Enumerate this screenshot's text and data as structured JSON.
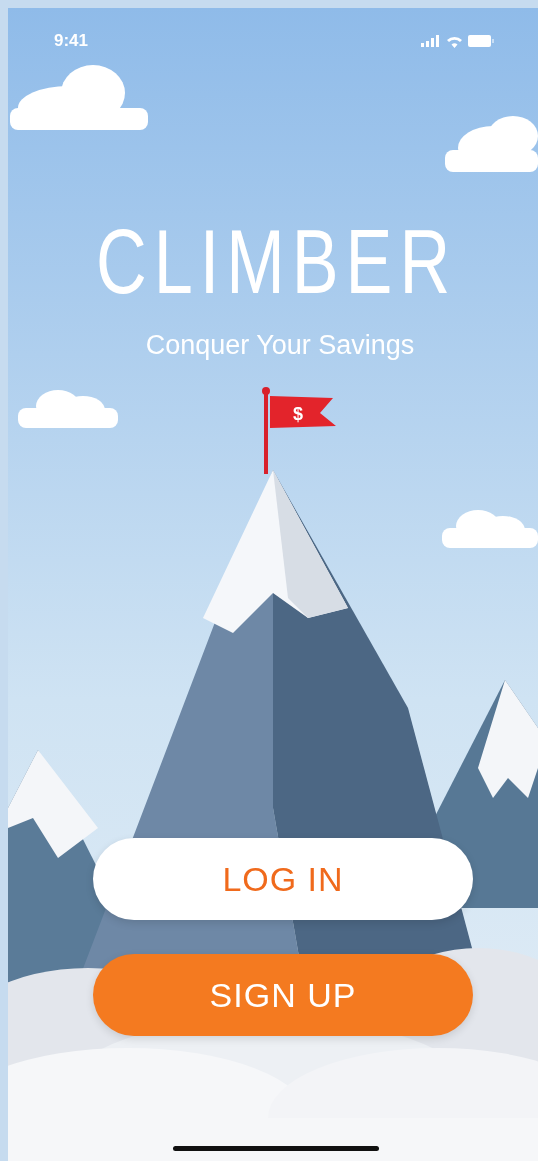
{
  "status_bar": {
    "time": "9:41"
  },
  "app": {
    "title": "CLIMBER",
    "tagline": "Conquer Your Savings"
  },
  "illustration": {
    "flag_symbol": "$"
  },
  "buttons": [
    {
      "label": "LOG IN",
      "kind": "secondary"
    },
    {
      "label": "SIGN UP",
      "kind": "primary"
    }
  ]
}
